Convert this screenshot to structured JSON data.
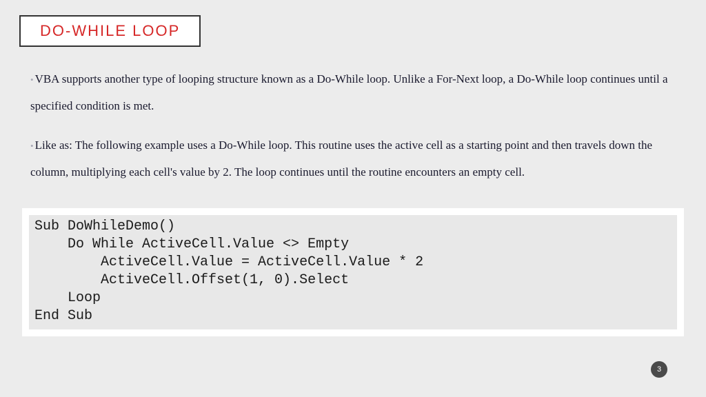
{
  "title": "DO-WHILE LOOP",
  "paragraphs": [
    "VBA supports another type of looping structure known as a Do-While loop. Unlike a For-Next loop, a Do-While loop continues until a specified condition is met.",
    "Like as: The following example uses a Do-While loop. This routine uses the active cell as a starting point and then travels down the column, multiplying each cell's value by 2. The loop continues until the routine encounters an empty cell."
  ],
  "code": "Sub DoWhileDemo()\n    Do While ActiveCell.Value <> Empty\n        ActiveCell.Value = ActiveCell.Value * 2\n        ActiveCell.Offset(1, 0).Select\n    Loop\nEnd Sub",
  "page_number": "3"
}
